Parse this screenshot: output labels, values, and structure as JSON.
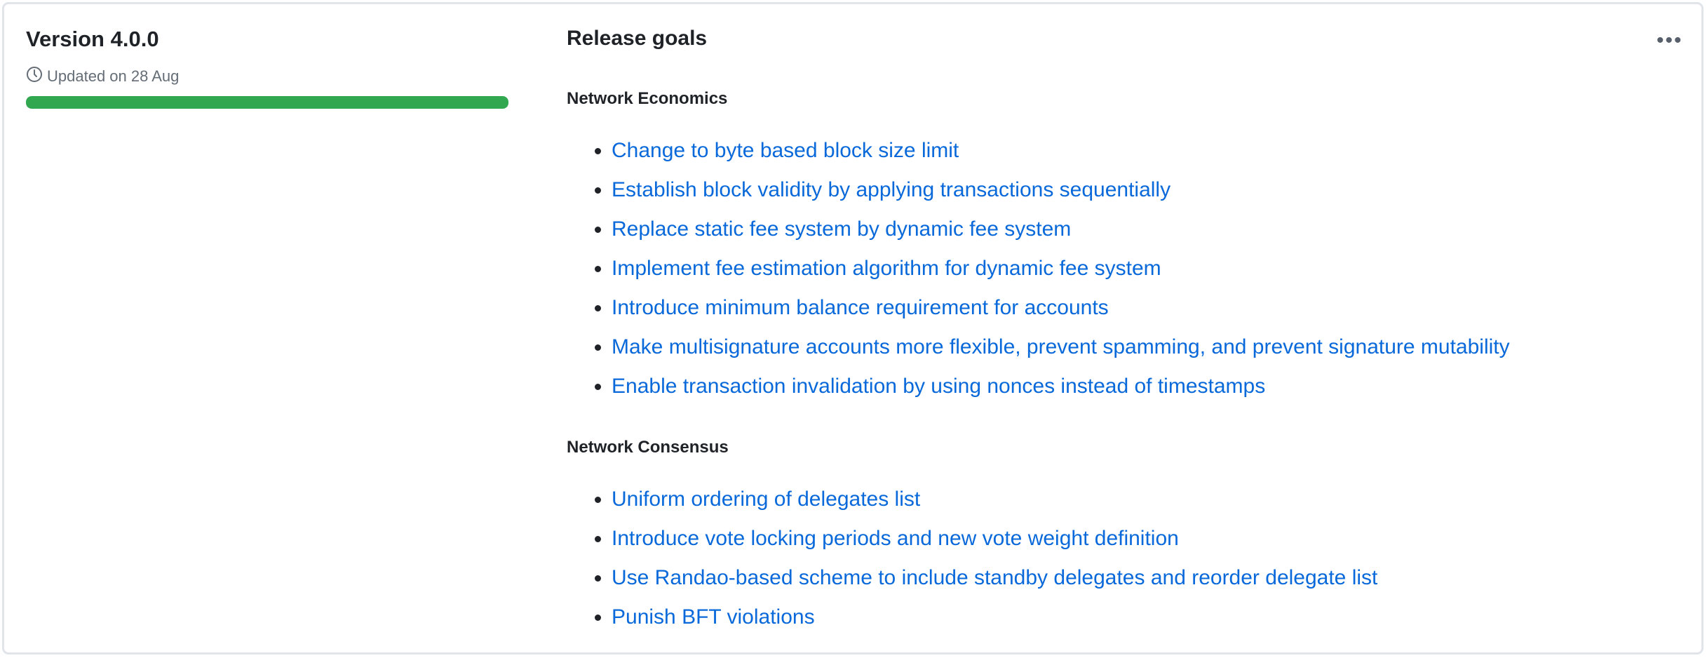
{
  "milestone": {
    "title": "Version 4.0.0",
    "updated": "Updated on 28 Aug",
    "progress_percent": 100,
    "progress_color": "#31a84f"
  },
  "menu_icon": "kebab-horizontal-icon",
  "description": {
    "heading": "Release goals",
    "sections": [
      {
        "title": "Network Economics",
        "items": [
          "Change to byte based block size limit",
          "Establish block validity by applying transactions sequentially",
          "Replace static fee system by dynamic fee system",
          "Implement fee estimation algorithm for dynamic fee system",
          "Introduce minimum balance requirement for accounts",
          "Make multisignature accounts more flexible, prevent spamming, and prevent signature mutability",
          "Enable transaction invalidation by using nonces instead of timestamps"
        ]
      },
      {
        "title": "Network Consensus",
        "items": [
          "Uniform ordering of delegates list",
          "Introduce vote locking periods and new vote weight definition",
          "Use Randao-based scheme to include standby delegates and reorder delegate list",
          "Punish BFT violations"
        ]
      }
    ]
  }
}
